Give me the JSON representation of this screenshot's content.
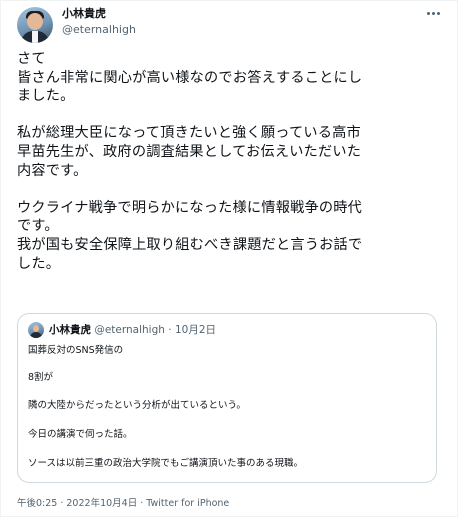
{
  "tweet": {
    "author_name": "小林貴虎",
    "author_handle": "@eternalhigh",
    "body_lines": [
      [
        "さて",
        "皆さん非常に関心が高い様なのでお答えすることにし",
        "ました。"
      ],
      [
        "私が総理大臣になって頂きたいと強く願っている高市",
        "早苗先生が、政府の調査結果としてお伝えいただいた",
        "内容です。"
      ],
      [
        "ウクライナ戦争で明らかになった様に情報戦争の時代",
        "です。",
        "我が国も安全保障上取り組むべき課題だと言うお話で",
        "した。"
      ]
    ],
    "timestamp": "午後0:25 · 2022年10月4日 · Twitter for iPhone"
  },
  "quote": {
    "author_name": "小林貴虎",
    "author_handle": "@eternalhigh",
    "separator": "·",
    "date": "10月2日",
    "lines": [
      "国葬反対のSNS発信の",
      "8割が",
      "隣の大陸からだったという分析が出ているという。",
      "今日の講演で伺った話。",
      "ソースは以前三重の政治大学院でもご講演頂いた事のある現職。"
    ]
  },
  "colors": {
    "text": "#0f1419",
    "secondary": "#536471",
    "border": "#cfd9de"
  },
  "icons": {
    "more": "more-horizontal-icon"
  }
}
